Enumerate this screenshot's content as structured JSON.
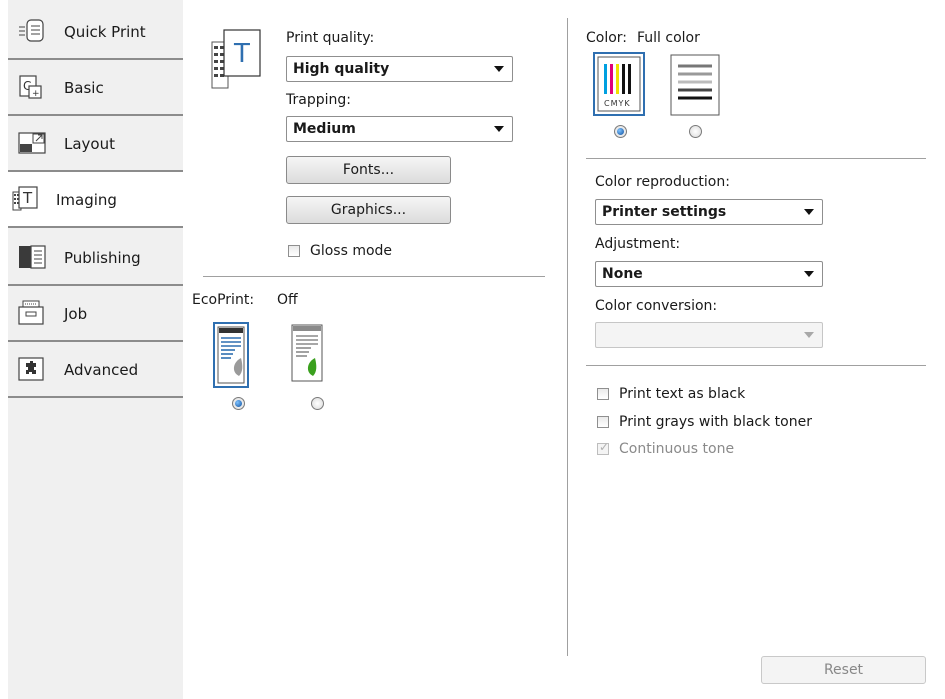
{
  "sidebar": {
    "tabs": [
      {
        "label": "Quick Print",
        "icon": "quick-print-icon"
      },
      {
        "label": "Basic",
        "icon": "basic-icon"
      },
      {
        "label": "Layout",
        "icon": "layout-icon"
      },
      {
        "label": "Imaging",
        "icon": "imaging-icon",
        "active": true
      },
      {
        "label": "Publishing",
        "icon": "publishing-icon"
      },
      {
        "label": "Job",
        "icon": "job-icon"
      },
      {
        "label": "Advanced",
        "icon": "advanced-icon"
      }
    ]
  },
  "imaging": {
    "print_quality_label": "Print quality:",
    "print_quality_value": "High quality",
    "trapping_label": "Trapping:",
    "trapping_value": "Medium",
    "fonts_button": "Fonts...",
    "graphics_button": "Graphics...",
    "gloss_mode_label": "Gloss mode",
    "gloss_mode_checked": false
  },
  "ecoprint": {
    "label": "EcoPrint:",
    "value": "Off",
    "selected_index": 0
  },
  "color": {
    "label": "Color:",
    "value": "Full color",
    "cmyk_text": "CMYK",
    "selected_index": 0,
    "reproduction_label": "Color reproduction:",
    "reproduction_value": "Printer settings",
    "adjustment_label": "Adjustment:",
    "adjustment_value": "None",
    "conversion_label": "Color conversion:",
    "conversion_value": "",
    "print_text_black_label": "Print text as black",
    "print_grays_label": "Print grays with black toner",
    "continuous_tone_label": "Continuous tone",
    "continuous_tone_checked": true
  },
  "footer": {
    "reset_button": "Reset"
  },
  "colors": {
    "cyan": "#00a0e0",
    "magenta": "#e0007a",
    "yellow": "#f0e000",
    "leaf_green": "#3aa01e",
    "selection_blue": "#2f6fb0"
  }
}
